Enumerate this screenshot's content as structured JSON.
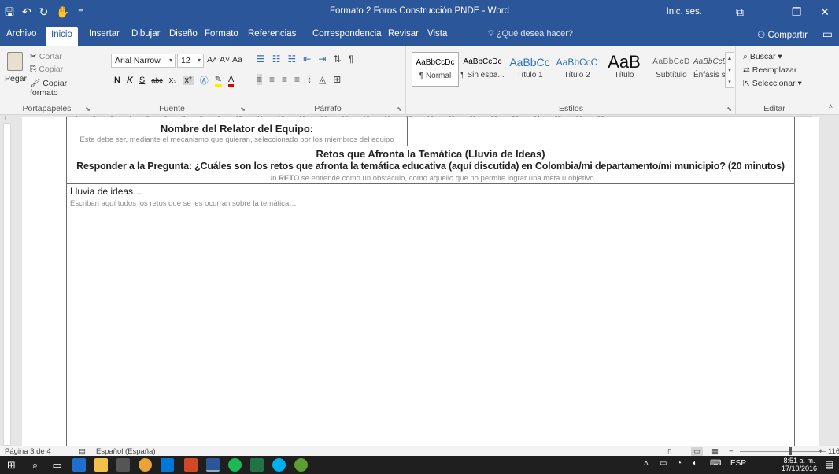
{
  "window": {
    "title": "Formato 2 Foros Construcción PNDE - Word",
    "signin": "Inic. ses.",
    "buttons": {
      "ribbon_display": "⧉",
      "minimize": "—",
      "restore": "❐",
      "close": "✕"
    }
  },
  "qat": {
    "save": "🖫",
    "undo": "↶",
    "redo": "↻",
    "touch": "✋",
    "more": "⁼"
  },
  "tabs": [
    {
      "label": "Archivo"
    },
    {
      "label": "Inicio"
    },
    {
      "label": "Insertar"
    },
    {
      "label": "Dibujar"
    },
    {
      "label": "Diseño"
    },
    {
      "label": "Formato"
    },
    {
      "label": "Referencias"
    },
    {
      "label": "Correspondencia"
    },
    {
      "label": "Revisar"
    },
    {
      "label": "Vista"
    }
  ],
  "tell_me": "¿Qué desea hacer?",
  "share": "Compartir",
  "ribbon": {
    "clipboard": {
      "paste": "Pegar",
      "cut": "Cortar",
      "copy": "Copiar",
      "format_painter": "Copiar formato",
      "label": "Portapapeles"
    },
    "font": {
      "name": "Arial Narrow",
      "size": "12",
      "grow": "A˄",
      "shrink": "A˅",
      "case": "Aa",
      "bold": "N",
      "italic": "K",
      "underline": "S",
      "strike": "abc",
      "subscript": "x₂",
      "superscript": "x²",
      "label": "Fuente"
    },
    "paragraph": {
      "label": "Párrafo"
    },
    "styles": {
      "label": "Estilos",
      "items": [
        {
          "sample": "AaBbCcDc",
          "name": "¶ Normal"
        },
        {
          "sample": "AaBbCcDc",
          "name": "¶ Sin espa..."
        },
        {
          "sample": "AaBbCc",
          "name": "Título 1"
        },
        {
          "sample": "AaBbCcC",
          "name": "Título 2"
        },
        {
          "sample": "AaB",
          "name": "Título"
        },
        {
          "sample": "AaBbCcD",
          "name": "Subtítulo"
        },
        {
          "sample": "AaBbCcDc",
          "name": "Énfasis sutil"
        }
      ]
    },
    "editing": {
      "find": "Buscar",
      "replace": "Reemplazar",
      "select": "Seleccionar",
      "label": "Editar"
    }
  },
  "document": {
    "relator_title": "Nombre del Relator del Equipo:",
    "relator_hint": "Este debe ser, mediante el mecanismo que quieran, seleccionado por los miembros del equipo",
    "retos_title": "Retos que Afronta la Temática (Lluvia de Ideas)",
    "question": "Responder a la Pregunta: ¿Cuáles son los retos que afronta la temática educativa (aquí discutida) en Colombia/mi departamento/mi municipio? (20 minutos)",
    "reto_def_pre": "Un ",
    "reto_def_bold": "RETO",
    "reto_def_post": " se entiende como un obstáculo, como aquello que no permite lograr una meta u objetivo",
    "lluvia_label": "Lluvia de ideas…",
    "lluvia_hint": "Escriban aquí todos los retos que se les ocurran sobre la temática…"
  },
  "status": {
    "page": "Página 3 de 4",
    "language": "Español (España)",
    "zoom": "116"
  },
  "taskbar": {
    "lang": "ESP",
    "time": "8:51 a. m.",
    "date": "17/10/2016"
  }
}
